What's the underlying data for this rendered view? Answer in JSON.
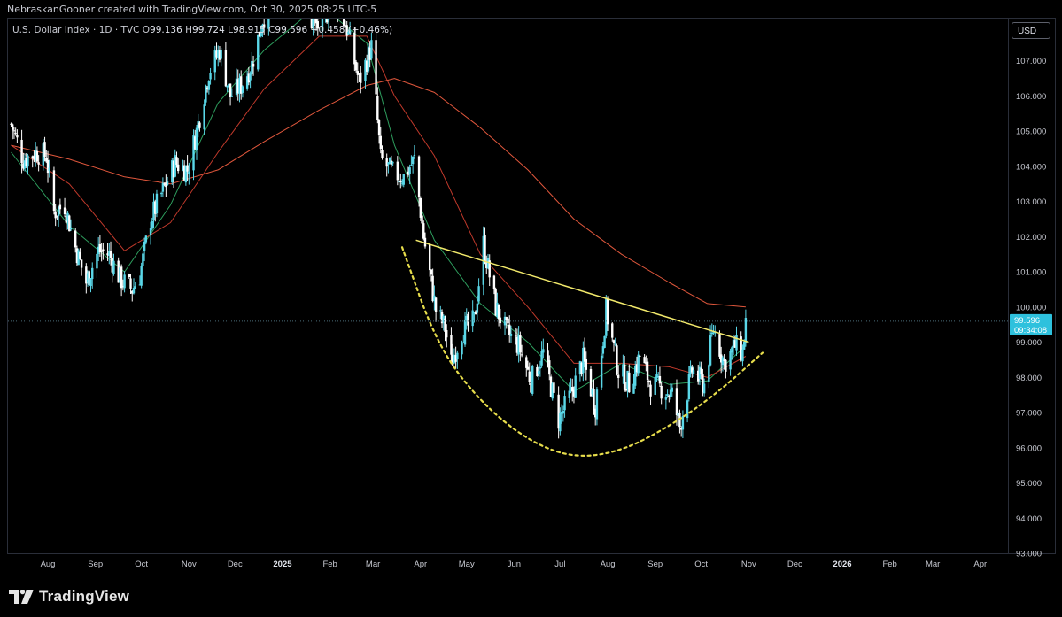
{
  "header": {
    "attribution": "NebraskanGooner created with TradingView.com, Oct 30, 2025 08:25 UTC-5"
  },
  "legend": {
    "symbol": "U.S. Dollar Index · 1D · TVC",
    "open_label": "O",
    "open": "99.136",
    "high_label": "H",
    "high": "99.724",
    "low_label": "L",
    "low": "98.915",
    "close_label": "C",
    "close": "99.596",
    "change": "+0.458 (+0.46%)"
  },
  "currency_button": "USD",
  "footer": {
    "brand": "TradingView"
  },
  "price_badge": {
    "price": "99.596",
    "countdown": "09:34:08"
  },
  "colors": {
    "background": "#000000",
    "candle_up": "#5ad7e8",
    "candle_down": "#ffffff",
    "ma_200": "#e0573c",
    "ma_50": "#c0392b",
    "ma_20": "#2e9e5e",
    "trendline": "#f2e96b",
    "cup": "#e6dc4b",
    "price_badge": "#2ec1dd"
  },
  "chart_data": {
    "type": "candlestick",
    "title": "U.S. Dollar Index · 1D · TVC",
    "ylim": [
      93,
      108.2
    ],
    "y_ticks": [
      93,
      94,
      95,
      96,
      97,
      98,
      99,
      100,
      101,
      102,
      103,
      104,
      105,
      106,
      107
    ],
    "y_tick_labels": [
      "93.000",
      "94.000",
      "95.000",
      "96.000",
      "97.000",
      "98.000",
      "99.000",
      "100.000",
      "101.000",
      "102.000",
      "103.000",
      "104.000",
      "105.000",
      "106.000",
      "107.000"
    ],
    "x_ticks": [
      {
        "label": "Aug",
        "date": "2024-08-01",
        "bold": false
      },
      {
        "label": "Sep",
        "date": "2024-09-01",
        "bold": false
      },
      {
        "label": "Oct",
        "date": "2024-10-01",
        "bold": false
      },
      {
        "label": "Nov",
        "date": "2024-11-01",
        "bold": false
      },
      {
        "label": "Dec",
        "date": "2024-12-01",
        "bold": false
      },
      {
        "label": "2025",
        "date": "2025-01-01",
        "bold": true
      },
      {
        "label": "Feb",
        "date": "2025-02-01",
        "bold": false
      },
      {
        "label": "Mar",
        "date": "2025-03-01",
        "bold": false
      },
      {
        "label": "Apr",
        "date": "2025-04-01",
        "bold": false
      },
      {
        "label": "May",
        "date": "2025-05-01",
        "bold": false
      },
      {
        "label": "Jun",
        "date": "2025-06-01",
        "bold": false
      },
      {
        "label": "Jul",
        "date": "2025-07-01",
        "bold": false
      },
      {
        "label": "Aug",
        "date": "2025-08-01",
        "bold": false
      },
      {
        "label": "Sep",
        "date": "2025-09-01",
        "bold": false
      },
      {
        "label": "Oct",
        "date": "2025-10-01",
        "bold": false
      },
      {
        "label": "Nov",
        "date": "2025-11-01",
        "bold": false
      },
      {
        "label": "Dec",
        "date": "2025-12-01",
        "bold": false
      },
      {
        "label": "2026",
        "date": "2026-01-01",
        "bold": true
      },
      {
        "label": "Feb",
        "date": "2026-02-01",
        "bold": false
      },
      {
        "label": "Mar",
        "date": "2026-03-01",
        "bold": false
      },
      {
        "label": "Apr",
        "date": "2026-04-01",
        "bold": false
      }
    ],
    "xlim": [
      "2024-07-06",
      "2026-04-19"
    ],
    "price_path": [
      [
        "2024-07-08",
        105.2
      ],
      [
        "2024-07-16",
        104.2
      ],
      [
        "2024-07-24",
        104.4
      ],
      [
        "2024-07-31",
        104.3
      ],
      [
        "2024-08-05",
        102.7
      ],
      [
        "2024-08-12",
        102.9
      ],
      [
        "2024-08-19",
        101.7
      ],
      [
        "2024-08-26",
        100.7
      ],
      [
        "2024-09-03",
        101.6
      ],
      [
        "2024-09-10",
        101.5
      ],
      [
        "2024-09-17",
        100.8
      ],
      [
        "2024-09-25",
        100.5
      ],
      [
        "2024-09-30",
        100.9
      ],
      [
        "2024-10-07",
        102.5
      ],
      [
        "2024-10-15",
        103.3
      ],
      [
        "2024-10-23",
        104.1
      ],
      [
        "2024-10-31",
        103.9
      ],
      [
        "2024-11-06",
        105.0
      ],
      [
        "2024-11-14",
        106.7
      ],
      [
        "2024-11-21",
        107.3
      ],
      [
        "2024-11-28",
        106.0
      ],
      [
        "2024-12-05",
        106.3
      ],
      [
        "2024-12-12",
        106.9
      ],
      [
        "2024-12-19",
        108.2
      ],
      [
        "2025-01-02",
        109.1
      ],
      [
        "2025-01-13",
        109.9
      ],
      [
        "2025-01-20",
        108.1
      ],
      [
        "2025-01-27",
        107.9
      ],
      [
        "2025-02-03",
        109.0
      ],
      [
        "2025-02-12",
        107.9
      ],
      [
        "2025-02-20",
        106.4
      ],
      [
        "2025-02-28",
        107.4
      ],
      [
        "2025-03-06",
        104.2
      ],
      [
        "2025-03-14",
        103.8
      ],
      [
        "2025-03-21",
        103.7
      ],
      [
        "2025-03-28",
        104.2
      ],
      [
        "2025-04-03",
        102.0
      ],
      [
        "2025-04-11",
        99.9
      ],
      [
        "2025-04-17",
        99.4
      ],
      [
        "2025-04-21",
        98.4
      ],
      [
        "2025-04-28",
        99.3
      ],
      [
        "2025-05-06",
        99.6
      ],
      [
        "2025-05-12",
        101.8
      ],
      [
        "2025-05-20",
        100.0
      ],
      [
        "2025-05-27",
        99.3
      ],
      [
        "2025-06-04",
        98.9
      ],
      [
        "2025-06-12",
        97.9
      ],
      [
        "2025-06-20",
        98.7
      ],
      [
        "2025-06-30",
        96.8
      ],
      [
        "2025-07-08",
        97.5
      ],
      [
        "2025-07-16",
        98.5
      ],
      [
        "2025-07-24",
        97.2
      ],
      [
        "2025-07-31",
        99.9
      ],
      [
        "2025-08-08",
        98.2
      ],
      [
        "2025-08-15",
        97.8
      ],
      [
        "2025-08-22",
        98.6
      ],
      [
        "2025-08-29",
        97.8
      ],
      [
        "2025-09-05",
        97.7
      ],
      [
        "2025-09-12",
        97.5
      ],
      [
        "2025-09-17",
        96.6
      ],
      [
        "2025-09-25",
        98.2
      ],
      [
        "2025-10-03",
        97.8
      ],
      [
        "2025-10-09",
        99.4
      ],
      [
        "2025-10-16",
        98.4
      ],
      [
        "2025-10-23",
        98.9
      ],
      [
        "2025-10-28",
        98.7
      ],
      [
        "2025-10-30",
        99.6
      ]
    ],
    "ma_200": [
      [
        "2024-07-08",
        104.6
      ],
      [
        "2024-08-15",
        104.2
      ],
      [
        "2024-09-20",
        103.7
      ],
      [
        "2024-10-20",
        103.5
      ],
      [
        "2024-11-20",
        103.9
      ],
      [
        "2024-12-20",
        104.7
      ],
      [
        "2025-01-25",
        105.6
      ],
      [
        "2025-02-25",
        106.3
      ],
      [
        "2025-03-15",
        106.5
      ],
      [
        "2025-04-10",
        106.1
      ],
      [
        "2025-05-10",
        105.1
      ],
      [
        "2025-06-10",
        103.9
      ],
      [
        "2025-07-10",
        102.5
      ],
      [
        "2025-08-10",
        101.5
      ],
      [
        "2025-09-10",
        100.7
      ],
      [
        "2025-10-05",
        100.1
      ],
      [
        "2025-10-30",
        100.0
      ]
    ],
    "ma_50": [
      [
        "2024-07-08",
        104.6
      ],
      [
        "2024-08-15",
        103.5
      ],
      [
        "2024-09-20",
        101.6
      ],
      [
        "2024-10-20",
        102.4
      ],
      [
        "2024-11-20",
        104.4
      ],
      [
        "2024-12-20",
        106.2
      ],
      [
        "2025-01-25",
        107.7
      ],
      [
        "2025-02-25",
        107.7
      ],
      [
        "2025-03-15",
        106.0
      ],
      [
        "2025-04-10",
        104.3
      ],
      [
        "2025-05-10",
        101.5
      ],
      [
        "2025-06-10",
        100.0
      ],
      [
        "2025-07-10",
        98.4
      ],
      [
        "2025-08-10",
        98.4
      ],
      [
        "2025-09-10",
        98.3
      ],
      [
        "2025-10-05",
        98.0
      ],
      [
        "2025-10-30",
        98.6
      ]
    ],
    "ma_20": [
      [
        "2024-07-08",
        104.4
      ],
      [
        "2024-08-15",
        102.3
      ],
      [
        "2024-09-20",
        101.0
      ],
      [
        "2024-10-20",
        102.9
      ],
      [
        "2024-11-20",
        105.8
      ],
      [
        "2024-12-20",
        107.3
      ],
      [
        "2025-01-25",
        108.6
      ],
      [
        "2025-02-25",
        107.5
      ],
      [
        "2025-03-15",
        104.6
      ],
      [
        "2025-04-10",
        101.9
      ],
      [
        "2025-05-10",
        100.1
      ],
      [
        "2025-06-10",
        99.0
      ],
      [
        "2025-07-10",
        97.6
      ],
      [
        "2025-08-10",
        98.4
      ],
      [
        "2025-09-10",
        97.8
      ],
      [
        "2025-10-05",
        97.9
      ],
      [
        "2025-10-30",
        98.9
      ]
    ],
    "trendline": [
      [
        "2025-03-29",
        101.9
      ],
      [
        "2025-11-01",
        99.0
      ]
    ],
    "cup": [
      [
        "2025-03-20",
        101.7
      ],
      [
        "2025-04-12",
        98.9
      ],
      [
        "2025-05-10",
        97.3
      ],
      [
        "2025-06-10",
        96.2
      ],
      [
        "2025-07-10",
        95.7
      ],
      [
        "2025-08-10",
        95.9
      ],
      [
        "2025-09-10",
        96.6
      ],
      [
        "2025-10-10",
        97.5
      ],
      [
        "2025-11-10",
        98.7
      ]
    ],
    "last_price": 99.596
  }
}
